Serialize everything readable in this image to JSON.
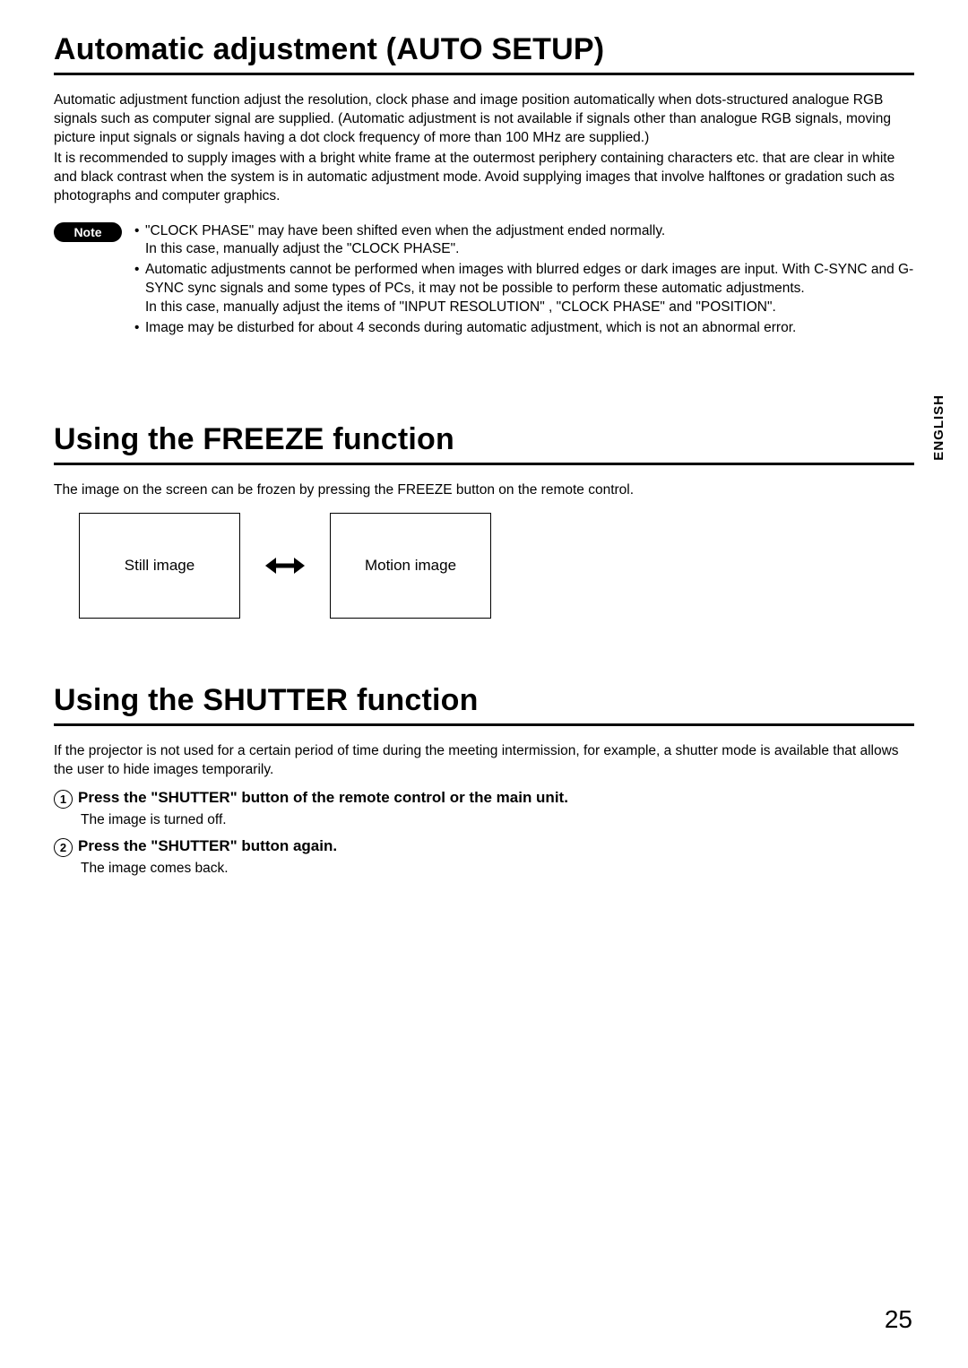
{
  "side_tab": "ENGLISH",
  "page_number": "25",
  "sections": {
    "auto_setup": {
      "title": "Automatic adjustment (AUTO SETUP)",
      "para1": "Automatic adjustment function adjust the resolution, clock phase and image position automatically when dots-structured analogue RGB signals such as computer signal are supplied. (Automatic adjustment is not available if signals other than analogue RGB signals, moving picture input signals or signals having a dot clock frequency of more than 100 MHz are supplied.)",
      "para2": "It is recommended to supply images with a bright white frame at the outermost periphery containing characters etc. that are clear in white and black contrast when the system is in automatic adjustment mode. Avoid supplying images that involve halftones or gradation such as photographs and computer graphics.",
      "note_label": "Note",
      "notes": [
        {
          "main": "\"CLOCK PHASE\" may have been shifted even when the adjustment ended normally.",
          "sub": "In this case, manually adjust the \"CLOCK PHASE\"."
        },
        {
          "main": "Automatic adjustments cannot be performed when images with blurred edges or dark images are input. With C-SYNC and G-SYNC sync signals and some types of PCs, it may not be possible to perform these automatic adjustments.",
          "sub": "In this case, manually adjust the items of \"INPUT RESOLUTION\" , \"CLOCK PHASE\" and \"POSITION\"."
        },
        {
          "main": "Image may be disturbed for about 4 seconds during automatic adjustment, which is not an abnormal error.",
          "sub": ""
        }
      ]
    },
    "freeze": {
      "title": "Using the FREEZE function",
      "para": "The image on the screen can be frozen by pressing the FREEZE button on the remote control.",
      "left_box": "Still image",
      "right_box": "Motion image"
    },
    "shutter": {
      "title": "Using the SHUTTER function",
      "para": "If the projector is not used for a certain period of time during the meeting intermission, for example, a shutter mode is available that allows the user to hide images temporarily.",
      "steps": [
        {
          "num": "1",
          "title": "Press the \"SHUTTER\" button of the remote control or the main unit.",
          "sub": "The image is turned off."
        },
        {
          "num": "2",
          "title": "Press the \"SHUTTER\" button again.",
          "sub": "The image comes back."
        }
      ]
    }
  }
}
